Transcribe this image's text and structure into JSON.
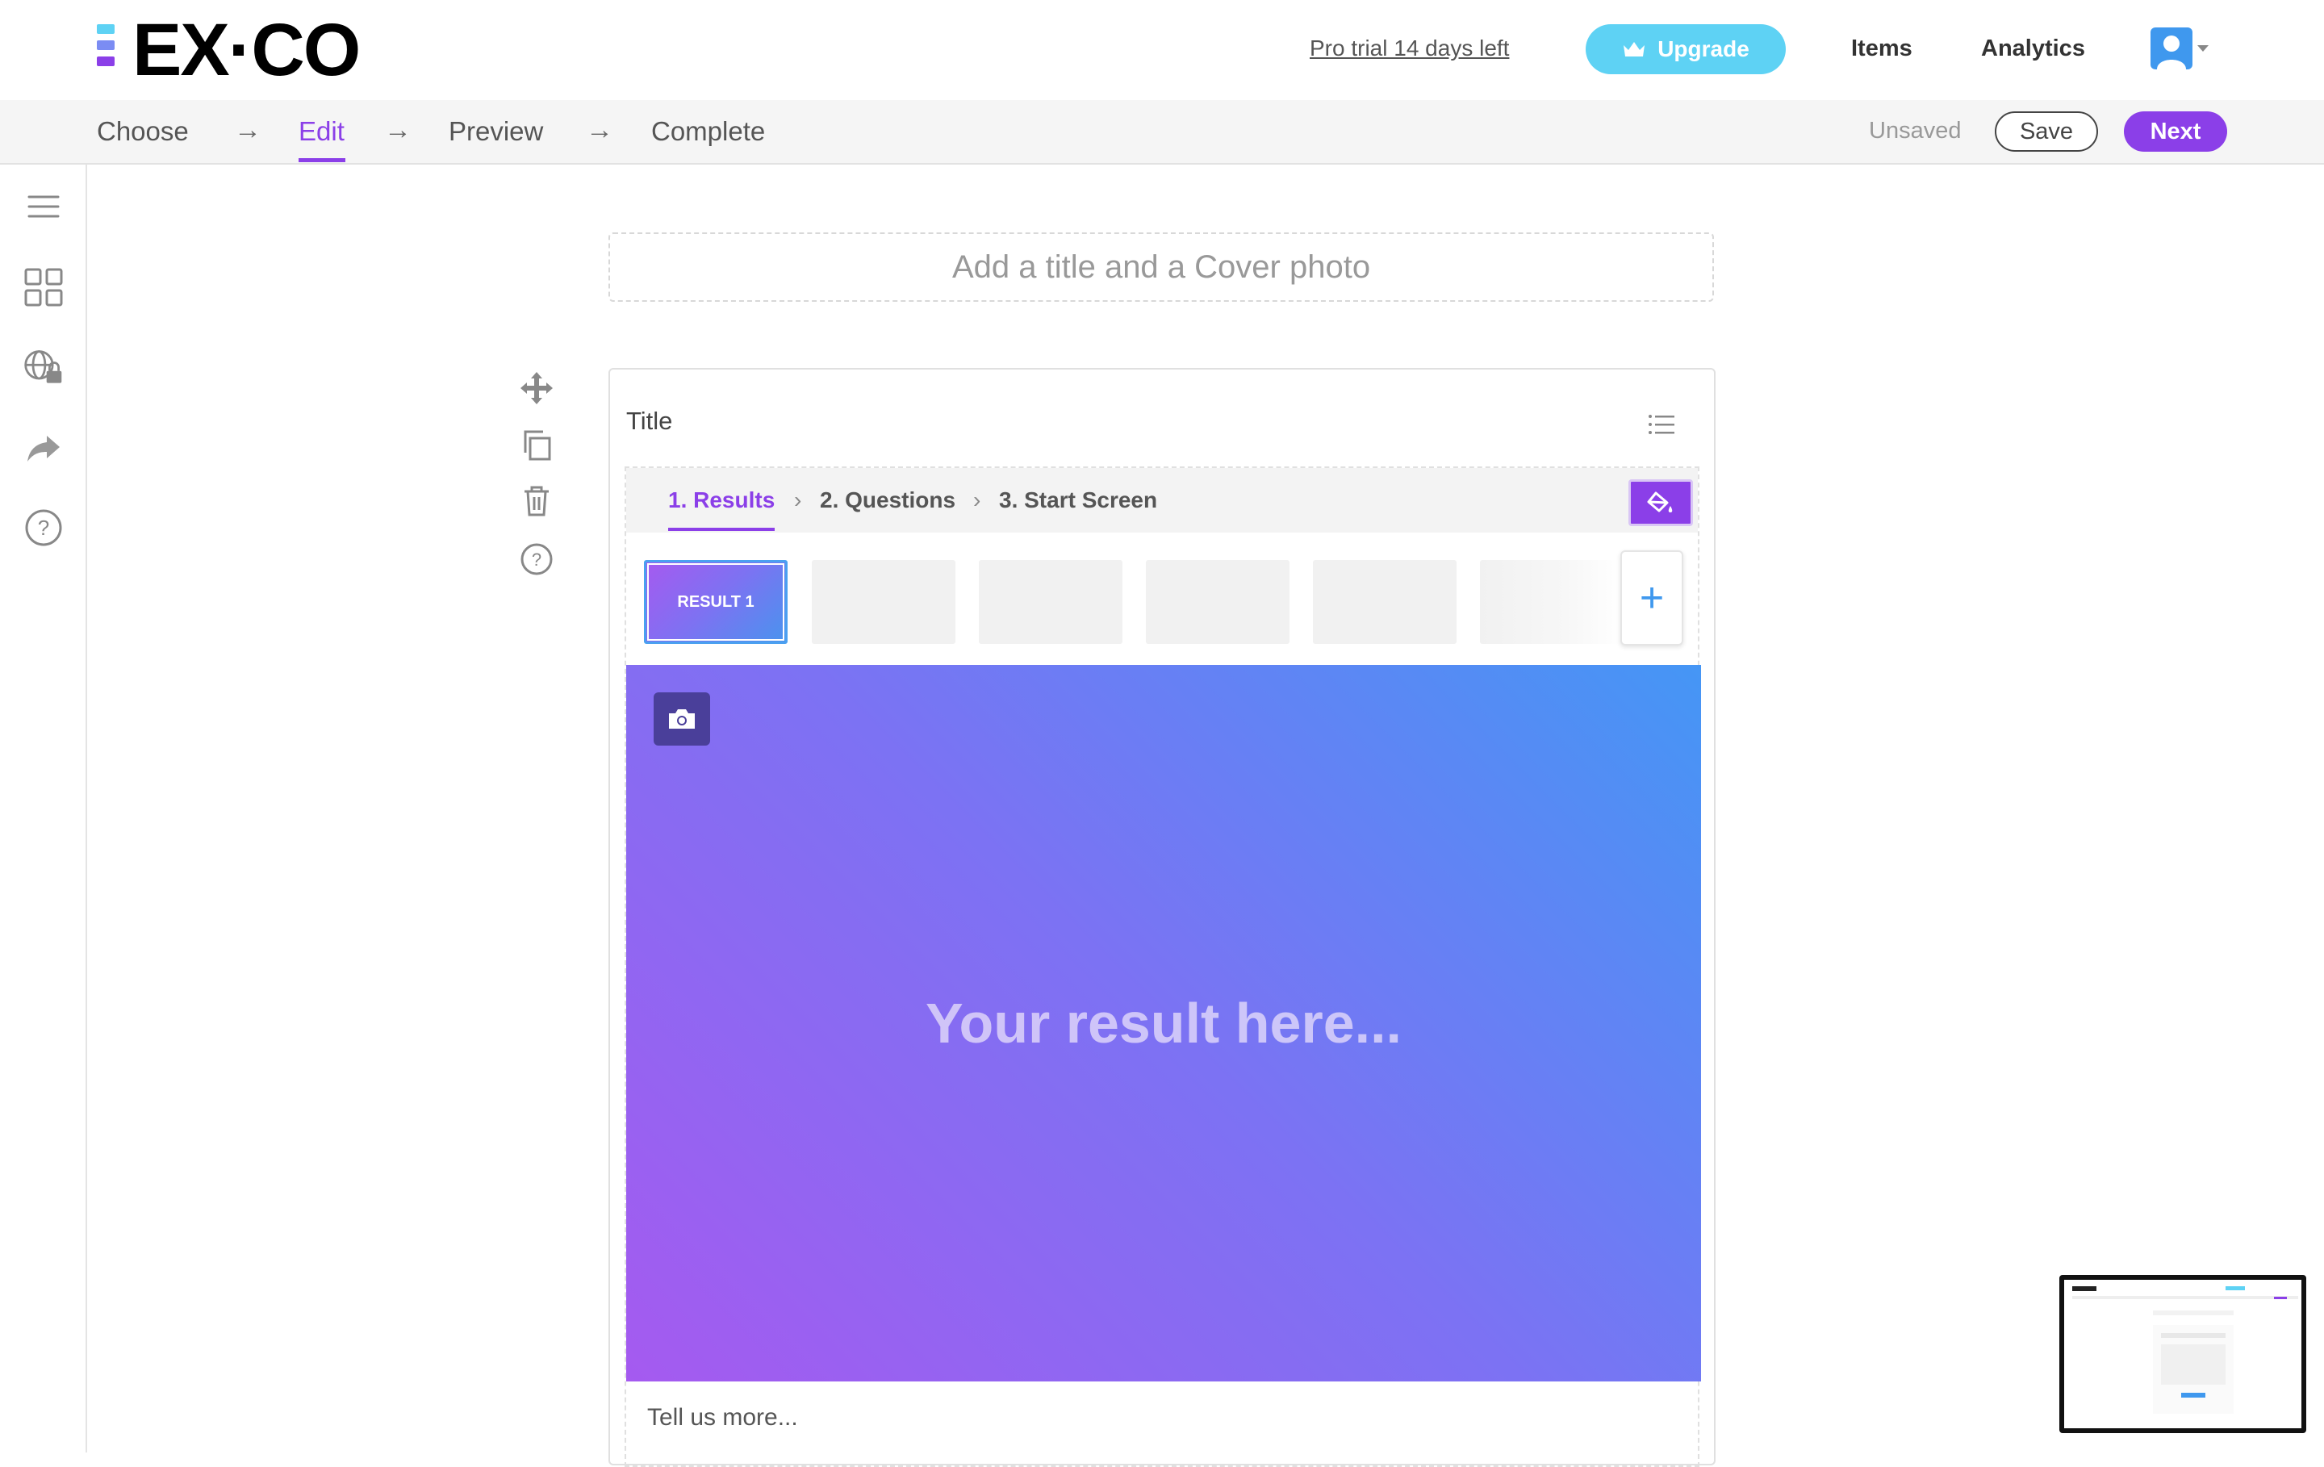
{
  "header": {
    "logo_text": "EX·CO",
    "trial_text": "Pro trial 14 days left",
    "upgrade_label": "Upgrade",
    "nav": {
      "items": "Items",
      "analytics": "Analytics"
    }
  },
  "steps": {
    "labels": [
      "Choose",
      "Edit",
      "Preview",
      "Complete"
    ],
    "active": "Edit",
    "arrow": "→",
    "status": "Unsaved",
    "save_label": "Save",
    "next_label": "Next"
  },
  "sidebar": {
    "icons": [
      "menu-icon",
      "grid-icon",
      "globe-lock-icon",
      "share-icon",
      "help-icon"
    ]
  },
  "editor": {
    "cover_placeholder": "Add a title and a Cover photo",
    "tools": [
      "move-icon",
      "duplicate-icon",
      "trash-icon",
      "help-icon"
    ],
    "card": {
      "title": "Title",
      "tabs": [
        "1. Results",
        "2. Questions",
        "3. Start Screen"
      ],
      "chevron": "›",
      "result_thumb_label": "RESULT 1",
      "add_symbol": "+",
      "hero_text": "Your result here...",
      "description_placeholder": "Tell us more..."
    }
  },
  "colors": {
    "accent": "#8b3fe8",
    "upgrade": "#5ed2f4",
    "blue": "#3f98ee",
    "gradient_start": "#a55af0",
    "gradient_end": "#4596f5"
  }
}
